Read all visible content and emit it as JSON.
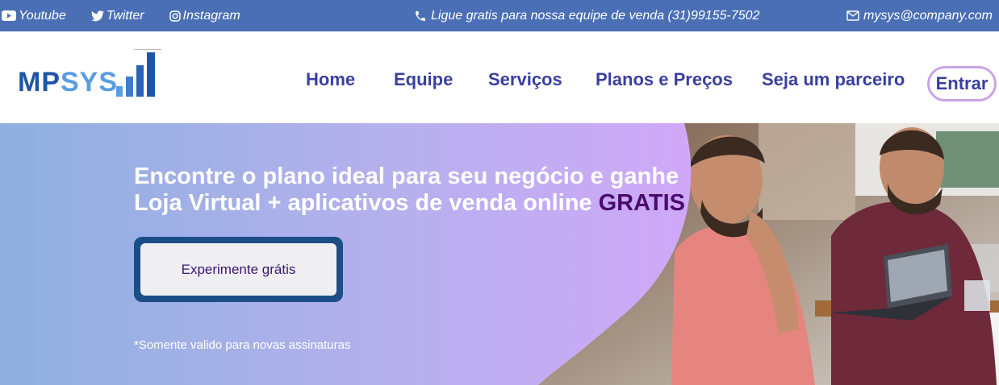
{
  "topbar": {
    "social": [
      {
        "label": "Youtube",
        "icon": "youtube-icon"
      },
      {
        "label": "Twitter",
        "icon": "twitter-icon"
      },
      {
        "label": "Instagram",
        "icon": "instagram-icon"
      }
    ],
    "phone_text": "Ligue gratis para nossa equipe de venda (31)99155-7502",
    "email": "mysys@company.com",
    "background": "#4a6fb5"
  },
  "logo": {
    "part1": "MP",
    "part2": "SYS",
    "icon": "bar-chart-icon"
  },
  "nav": {
    "items": [
      "Home",
      "Equipe",
      "Serviços",
      "Planos e Preços",
      "Seja um parceiro"
    ],
    "login": "Entrar",
    "link_color": "#3a3fa0"
  },
  "hero": {
    "headline_line1": "Encontre o plano ideal para seu negócio e ganhe",
    "headline_line2": "Loja Virtual + aplicativos de venda online",
    "headline_highlight": "GRATIS",
    "cta": "Experimente grátis",
    "note": "*Somente valido para novas assinaturas",
    "accent": "#4b0a6e"
  }
}
